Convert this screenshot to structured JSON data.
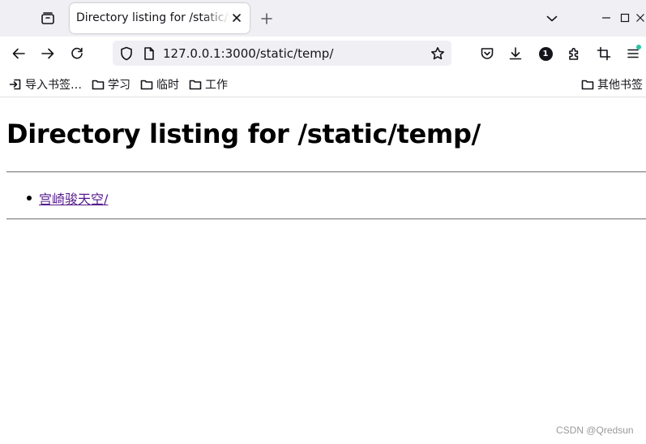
{
  "window": {
    "tab": {
      "title": "Directory listing for /static/temp/"
    }
  },
  "navbar": {
    "url": "127.0.0.1:3000/static/temp/",
    "extension_badge": "1"
  },
  "bookmarks": {
    "items": [
      {
        "label": "导入书签…",
        "icon": "import-icon"
      },
      {
        "label": "学习",
        "icon": "folder-icon"
      },
      {
        "label": "临时",
        "icon": "folder-icon"
      },
      {
        "label": "工作",
        "icon": "folder-icon"
      }
    ],
    "other": {
      "label": "其他书签",
      "icon": "folder-icon"
    }
  },
  "page": {
    "heading": "Directory listing for /static/temp/",
    "entries": [
      {
        "name": "宫崎骏天空/"
      }
    ]
  },
  "watermark": "CSDN @Qredsun"
}
